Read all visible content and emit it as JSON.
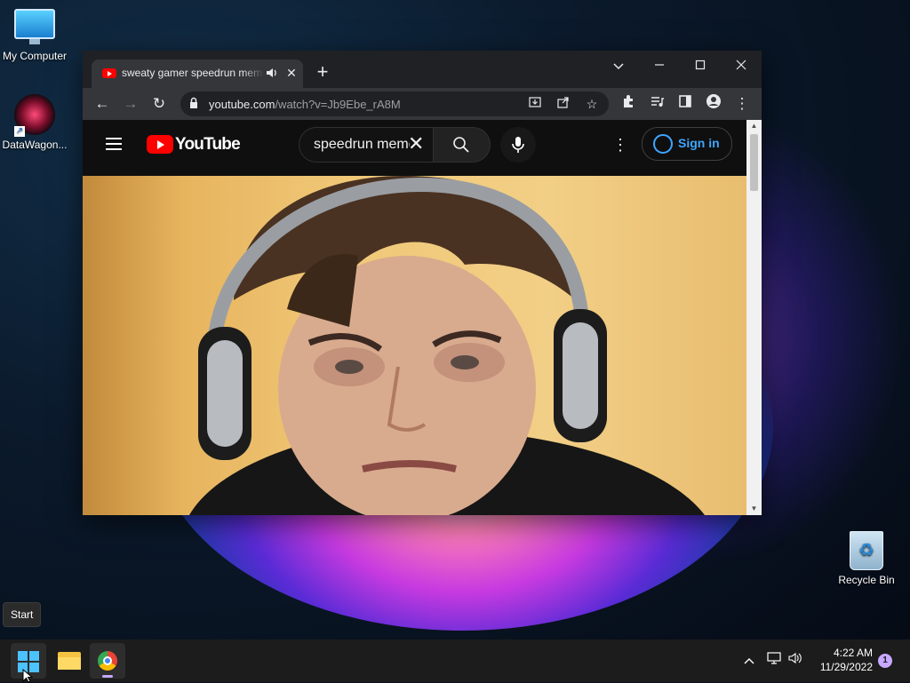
{
  "desktop": {
    "icons": [
      {
        "label": "My Computer",
        "icon": "monitor-icon"
      },
      {
        "label": "DataWagon...",
        "icon": "datawagon-app-icon"
      },
      {
        "label": "Recycle Bin",
        "icon": "recycle-bin-icon"
      }
    ]
  },
  "browser": {
    "tab": {
      "title": "sweaty gamer speedrun meme",
      "favicon": "youtube-favicon-icon",
      "audio_icon": "speaker-icon",
      "close": "✕"
    },
    "new_tab": "+",
    "window_controls": {
      "dropdown": "⌄",
      "minimize": "—",
      "maximize": "☐",
      "close": "✕"
    },
    "toolbar": {
      "back": "←",
      "forward": "→",
      "reload": "↻",
      "url_domain": "youtube.com",
      "url_path": "/watch?v=Jb9Ebe_rA8M"
    }
  },
  "youtube": {
    "logo_text": "YouTube",
    "search_query": "speedrun meme",
    "clear": "✕",
    "more": "⋮",
    "sign_in": "Sign in"
  },
  "taskbar": {
    "tooltip": "Start",
    "time": "4:22 AM",
    "date": "11/29/2022",
    "notification_count": "1",
    "accent": "#4cc2ff"
  }
}
